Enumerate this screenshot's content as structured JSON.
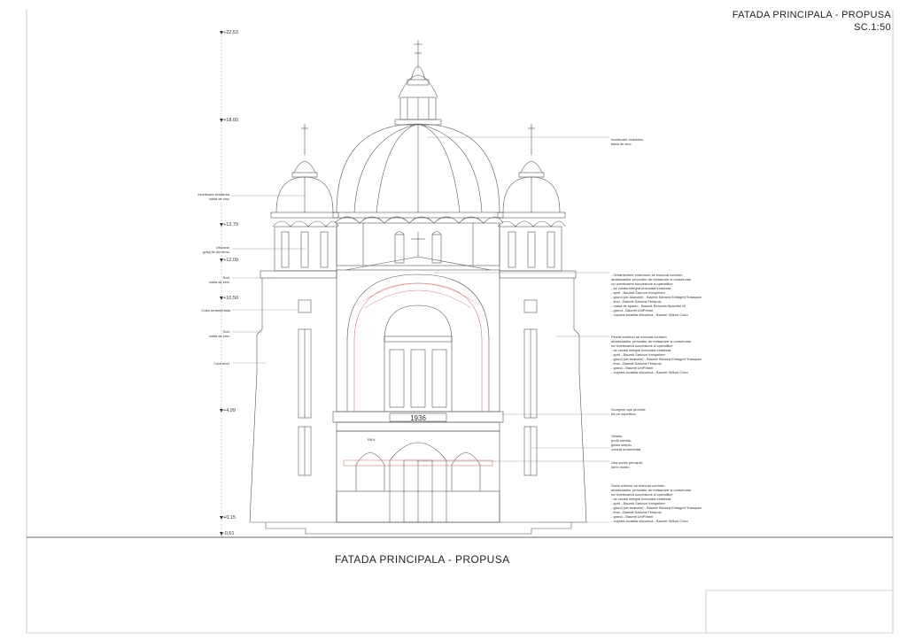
{
  "title": {
    "line1": "FATADA PRINCIPALA  - PROPUSA",
    "line2": "SC.1:50"
  },
  "bottom_title": "FATADA PRINCIPALA - PROPUSA",
  "date_panel": "1936",
  "arch_label": "R8.6",
  "levels": [
    {
      "id": "lvl-2253",
      "text": "+22,53"
    },
    {
      "id": "lvl-1860",
      "text": "+18,60"
    },
    {
      "id": "lvl-1379",
      "text": "+13,79"
    },
    {
      "id": "lvl-1209",
      "text": "+12,09"
    },
    {
      "id": "lvl-1050",
      "text": "+10,50"
    },
    {
      "id": "lvl-499",
      "text": "+4,99"
    },
    {
      "id": "lvl-015",
      "text": "+0,15"
    },
    {
      "id": "lvl-061",
      "text": "-0,61"
    }
  ],
  "notes_left": [
    {
      "id": "note-invelitoare-left",
      "lines": [
        "Invelitoare existenta,",
        "tabla de zinc."
      ]
    },
    {
      "id": "note-obloane",
      "lines": [
        "Obloane,",
        "grilaj fix din lemn."
      ]
    },
    {
      "id": "note-sort-1",
      "lines": [
        "Sort,",
        "tabla de zinc."
      ]
    },
    {
      "id": "note-cosa",
      "lines": [
        "Cosa ornamentala"
      ]
    },
    {
      "id": "note-sort-2",
      "lines": [
        "Sort,",
        "tabla de zinc."
      ]
    },
    {
      "id": "note-contrafort",
      "lines": [
        "Contrafort."
      ]
    }
  ],
  "notes_right": [
    {
      "id": "note-invelitoare-right",
      "lines": [
        "Invelitoare existenta,",
        "tabla de zinc."
      ]
    },
    {
      "id": "note-ornamentele",
      "lines": [
        "- Ornamentele exterioare se executa conform",
        "  amatusasilor procedee de restaurare si conservare",
        "  cu urmatoarea succesiune a operatiilor:",
        "- se curata integral tencuiala existenta",
        "- sprit - Baumit Sanova Vorspritzer",
        "- grund (de asanare) - Baumit Sanova Einlagen/Trasspulz",
        "- tinci - Baumit Sanova Feinputz",
        "- masa de spaclu - Baumit RenovierSpachtel W",
        "- grund - Baumit UniPrimer",
        "- vopsea lavabila siliconica - Baumit Silikon Color"
      ]
    },
    {
      "id": "note-peretii",
      "lines": [
        "Peretii exteriori se executa conform",
        "  amatusasilor procedee de restaurare si conservare",
        "  cu urmatoarea succesiune a operatiilor:",
        "- se curata integral tencuiala existenta",
        "- sprit - Baumit Sanova Vorspritzer",
        "- grund (de asanare) - Baumit Sanova Einlagen/Trasspulz",
        "- tinci - Baumit Sanova Feinputz",
        "- grund - Baumit UniPrimer",
        "- vopsea lavabila siliconica - Baumit Silikon Color"
      ]
    },
    {
      "id": "note-scurgere",
      "lines": [
        "Scurgere ape pluviale",
        "de pe copertina."
      ]
    },
    {
      "id": "note-vitraliu",
      "lines": [
        "Vitraliu,",
        "profil metalic,",
        "geam simplu",
        "colorat ornamental."
      ]
    },
    {
      "id": "note-usa",
      "lines": [
        "Usa acces principal,",
        "lemn masiv."
      ]
    },
    {
      "id": "note-soclu",
      "lines": [
        "Soclu exterior se executa conform",
        "  amatusasilor procedee de restaurare si conservare",
        "  cu urmatoarea succesiune a operatiilor:",
        "- se curata integral tencuiala existenta",
        "- sprit - Baumit Sanova Vorspritzer",
        "- grund (de asanare) - Baumit Sanova Einlagen/Trasspulz",
        "- tinci - Baumit Sanova Feinputz",
        "- grund - Baumit UniPrimer",
        "- vopsea lavabila siliconica - Baumit Silikon Color"
      ]
    }
  ],
  "colors": {
    "line": "#555555",
    "accent": "#c98080",
    "ground": "#333333"
  }
}
